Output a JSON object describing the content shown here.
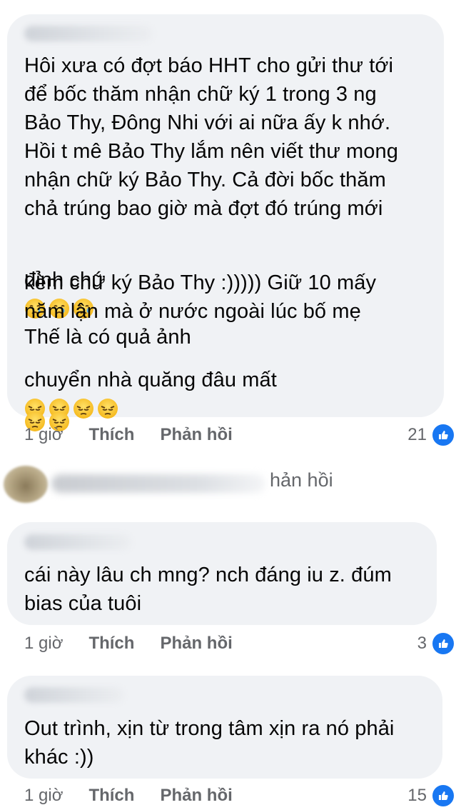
{
  "comments": [
    {
      "text": "Hôi xưa có đợt báo HHT cho gửi thư tới\nđể bốc thăm nhận chữ ký 1 trong 3 ng\nBảo Thy, Đông Nhi với ai nữa ấy k nhớ.\nHồi t mê Bảo Thy lắm nên viết thư mong\nnhận chữ ký Bảo Thy. Cả đời bốc thăm\nchả trúng bao giờ mà đợt đó trúng mới",
      "line_a": "đỉnh chứ",
      "line_a_tail": "Thế là có quả ảnh",
      "text_b": "kèm chữ ký Bảo Thy :))))) Giữ 10 mấy\nnăm lận mà ở nước ngoài lúc bố mẹ",
      "line_c": "chuyển nhà quăng đâu mất",
      "time": "1 giờ",
      "like_label": "Thích",
      "reply_label": "Phản hồi",
      "reaction_count": "21"
    },
    {
      "text": "cái này lâu ch mng? nch đáng iu z. đúm\nbias của tuôi",
      "time": "1 giờ",
      "like_label": "Thích",
      "reply_label": "Phản hồi",
      "reaction_count": "3"
    },
    {
      "text": "Out trình, xịn từ trong tâm xịn ra nó phải\nkhác :))",
      "time": "1 giờ",
      "like_label": "Thích",
      "reply_label": "Phản hồi",
      "reaction_count": "15"
    }
  ],
  "reply_preview": {
    "text": "hản hồi"
  },
  "colors": {
    "bubble": "#f0f2f5",
    "like": "#1877f2",
    "meta": "#65676b"
  },
  "icons": {
    "crying": "crying-face-icon",
    "pensive": "pensive-face-icon",
    "like": "thumbs-up-icon"
  }
}
